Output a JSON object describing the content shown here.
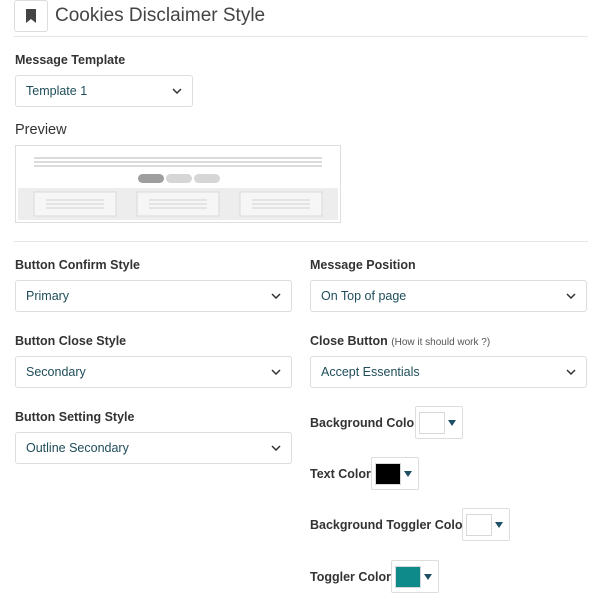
{
  "header": {
    "title": "Cookies Disclaimer Style",
    "icon": "bookmark-icon"
  },
  "message_template": {
    "label": "Message Template",
    "value": "Template 1"
  },
  "preview": {
    "title": "Preview"
  },
  "button_confirm_style": {
    "label": "Button Confirm Style",
    "value": "Primary"
  },
  "button_close_style": {
    "label": "Button Close Style",
    "value": "Secondary"
  },
  "button_setting_style": {
    "label": "Button Setting Style",
    "value": "Outline Secondary"
  },
  "message_position": {
    "label": "Message Position",
    "value": "On Top of page"
  },
  "close_button": {
    "label": "Close Button",
    "hint": "(How it should work ?)",
    "value": "Accept Essentials"
  },
  "colors": {
    "background": {
      "label": "Background Color",
      "value": "#ffffff"
    },
    "text": {
      "label": "Text Color",
      "value": "#000000"
    },
    "background_toggler": {
      "label": "Background Toggler Color",
      "value": "#ffffff"
    },
    "toggler": {
      "label": "Toggler Color",
      "value": "#0e8a8a"
    }
  },
  "theme": {
    "caret_color": "#1e4f66",
    "select_text_color": "#1f4d5a"
  }
}
